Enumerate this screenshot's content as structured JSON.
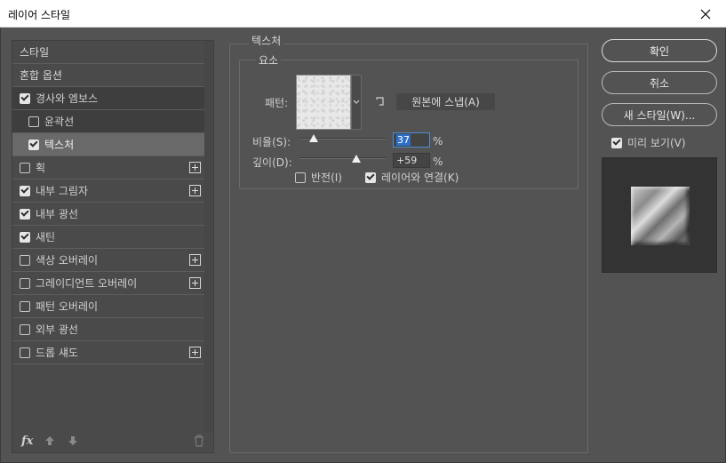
{
  "window": {
    "title": "레이어 스타일"
  },
  "style_list": {
    "items": [
      {
        "label": "스타일",
        "type": "header"
      },
      {
        "label": "혼합 옵션",
        "type": "header"
      },
      {
        "label": "경사와 엠보스",
        "checked": true
      },
      {
        "label": "윤곽선",
        "checked": false
      },
      {
        "label": "텍스처",
        "checked": true
      },
      {
        "label": "획",
        "checked": false
      },
      {
        "label": "내부 그림자",
        "checked": true
      },
      {
        "label": "내부 광선",
        "checked": true
      },
      {
        "label": "새틴",
        "checked": true
      },
      {
        "label": "색상 오버레이",
        "checked": false
      },
      {
        "label": "그레이디언트 오버레이",
        "checked": false
      },
      {
        "label": "패턴 오버레이",
        "checked": false
      },
      {
        "label": "외부 광선",
        "checked": false
      },
      {
        "label": "드롭 섀도",
        "checked": false
      }
    ],
    "fx_label": "fx"
  },
  "texture_panel": {
    "title": "텍스처",
    "elements_title": "요소",
    "pattern_label": "패턴:",
    "snap_button": "원본에 스냅(A)",
    "scale_label": "비율(S):",
    "scale_value": "37",
    "scale_unit": "%",
    "scale_level": 37,
    "depth_label": "깊이(D):",
    "depth_value": "+59",
    "depth_unit": "%",
    "depth_level": 59,
    "invert_label": "반전(I)",
    "invert_checked": false,
    "link_label": "레이어와 연결(K)",
    "link_checked": true
  },
  "actions": {
    "ok": "확인",
    "cancel": "취소",
    "new_style": "새 스타일(W)...",
    "preview_label": "미리 보기(V)",
    "preview_checked": true
  },
  "icons": {
    "close": "close-icon",
    "add": "plus-icon",
    "up": "arrow-up-icon",
    "down": "arrow-down-icon",
    "trash": "trash-icon",
    "snap": "snap-origin-icon",
    "dropdown": "chevron-down-icon"
  }
}
